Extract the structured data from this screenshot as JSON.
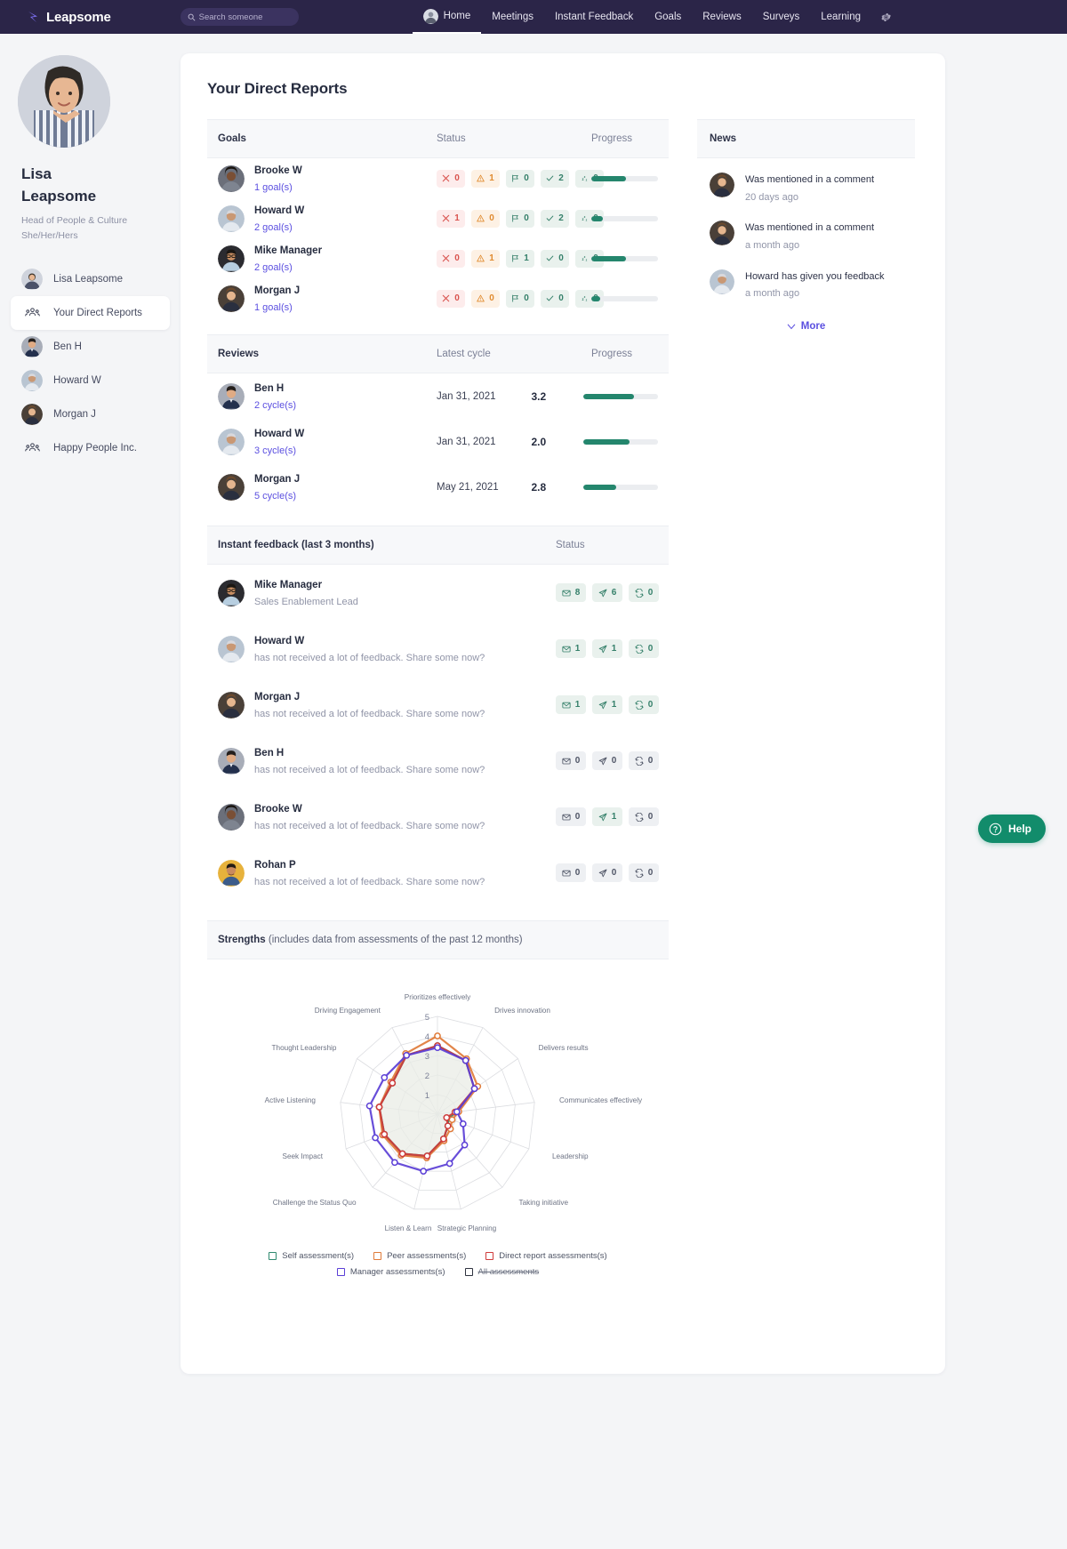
{
  "nav": {
    "brand": "Leapsome",
    "search_placeholder": "Search someone",
    "items": [
      {
        "label": "Home",
        "active": true
      },
      {
        "label": "Meetings",
        "active": false
      },
      {
        "label": "Instant Feedback",
        "active": false
      },
      {
        "label": "Goals",
        "active": false
      },
      {
        "label": "Reviews",
        "active": false
      },
      {
        "label": "Surveys",
        "active": false
      },
      {
        "label": "Learning",
        "active": false
      }
    ]
  },
  "sidebar": {
    "name": "Lisa\nLeapsome",
    "name_line1": "Lisa",
    "name_line2": "Leapsome",
    "role": "Head of People & Culture",
    "pronouns": "She/Her/Hers",
    "items": [
      {
        "label": "Lisa Leapsome",
        "type": "avatar",
        "selected": false
      },
      {
        "label": "Your Direct Reports",
        "type": "group-icon",
        "selected": true
      },
      {
        "label": "Ben H",
        "type": "avatar",
        "selected": false
      },
      {
        "label": "Howard W",
        "type": "avatar",
        "selected": false
      },
      {
        "label": "Morgan J",
        "type": "avatar",
        "selected": false
      },
      {
        "label": "Happy People Inc.",
        "type": "group-icon",
        "selected": false
      }
    ]
  },
  "main": {
    "page_title": "Your Direct Reports",
    "goals": {
      "header": {
        "title": "Goals",
        "status": "Status",
        "progress": "Progress"
      },
      "rows": [
        {
          "name": "Brooke W",
          "link": "1 goal(s)",
          "chips": [
            {
              "icon": "x",
              "tone": "red",
              "value": "0"
            },
            {
              "icon": "warn",
              "tone": "amber",
              "value": "1"
            },
            {
              "icon": "flag",
              "tone": "green",
              "value": "0"
            },
            {
              "icon": "check",
              "tone": "green",
              "value": "2"
            },
            {
              "icon": "zzz",
              "tone": "green",
              "value": "0"
            }
          ],
          "progress": 52
        },
        {
          "name": "Howard W",
          "link": "2 goal(s)",
          "chips": [
            {
              "icon": "x",
              "tone": "red",
              "value": "1"
            },
            {
              "icon": "warn",
              "tone": "amber",
              "value": "0"
            },
            {
              "icon": "flag",
              "tone": "green",
              "value": "0"
            },
            {
              "icon": "check",
              "tone": "green",
              "value": "2"
            },
            {
              "icon": "zzz",
              "tone": "green",
              "value": "0"
            }
          ],
          "progress": 17
        },
        {
          "name": "Mike Manager",
          "link": "2 goal(s)",
          "chips": [
            {
              "icon": "x",
              "tone": "red",
              "value": "0"
            },
            {
              "icon": "warn",
              "tone": "amber",
              "value": "1"
            },
            {
              "icon": "flag",
              "tone": "green",
              "value": "1"
            },
            {
              "icon": "check",
              "tone": "green",
              "value": "0"
            },
            {
              "icon": "zzz",
              "tone": "green",
              "value": "0"
            }
          ],
          "progress": 52
        },
        {
          "name": "Morgan J",
          "link": "1 goal(s)",
          "chips": [
            {
              "icon": "x",
              "tone": "red",
              "value": "0"
            },
            {
              "icon": "warn",
              "tone": "amber",
              "value": "0"
            },
            {
              "icon": "flag",
              "tone": "green",
              "value": "0"
            },
            {
              "icon": "check",
              "tone": "green",
              "value": "0"
            },
            {
              "icon": "zzz",
              "tone": "green",
              "value": "0"
            }
          ],
          "progress": 13
        }
      ]
    },
    "reviews": {
      "header": {
        "title": "Reviews",
        "cycle": "Latest cycle",
        "progress": "Progress"
      },
      "rows": [
        {
          "name": "Ben H",
          "link": "2 cycle(s)",
          "date": "Jan 31, 2021",
          "score": "3.2",
          "progress": 68
        },
        {
          "name": "Howard W",
          "link": "3 cycle(s)",
          "date": "Jan 31, 2021",
          "score": "2.0",
          "progress": 62
        },
        {
          "name": "Morgan J",
          "link": "5 cycle(s)",
          "date": "May 21, 2021",
          "score": "2.8",
          "progress": 44
        }
      ]
    },
    "feedback": {
      "header": {
        "title": "Instant feedback (last 3 months)",
        "status": "Status"
      },
      "rows": [
        {
          "name": "Mike Manager",
          "sub": "Sales Enablement Lead",
          "sub_type": "role",
          "chips": [
            {
              "icon": "envelope",
              "value": "8",
              "on": true
            },
            {
              "icon": "paper-plane",
              "value": "6",
              "on": true
            },
            {
              "icon": "loop",
              "value": "0",
              "on": true
            }
          ]
        },
        {
          "name": "Howard W",
          "sub": "has not received a lot of feedback. Share some now?",
          "sub_type": "prompt",
          "chips": [
            {
              "icon": "envelope",
              "value": "1",
              "on": true
            },
            {
              "icon": "paper-plane",
              "value": "1",
              "on": true
            },
            {
              "icon": "loop",
              "value": "0",
              "on": true
            }
          ]
        },
        {
          "name": "Morgan J",
          "sub": "has not received a lot of feedback. Share some now?",
          "sub_type": "prompt",
          "chips": [
            {
              "icon": "envelope",
              "value": "1",
              "on": true
            },
            {
              "icon": "paper-plane",
              "value": "1",
              "on": true
            },
            {
              "icon": "loop",
              "value": "0",
              "on": true
            }
          ]
        },
        {
          "name": "Ben H",
          "sub": "has not received a lot of feedback. Share some now?",
          "sub_type": "prompt",
          "chips": [
            {
              "icon": "envelope",
              "value": "0",
              "on": false
            },
            {
              "icon": "paper-plane",
              "value": "0",
              "on": false
            },
            {
              "icon": "loop",
              "value": "0",
              "on": false
            }
          ]
        },
        {
          "name": "Brooke W",
          "sub": "has not received a lot of feedback. Share some now?",
          "sub_type": "prompt",
          "chips": [
            {
              "icon": "envelope",
              "value": "0",
              "on": false
            },
            {
              "icon": "paper-plane",
              "value": "1",
              "on": true
            },
            {
              "icon": "loop",
              "value": "0",
              "on": false
            }
          ]
        },
        {
          "name": "Rohan P",
          "sub": "has not received a lot of feedback. Share some now?",
          "sub_type": "prompt",
          "chips": [
            {
              "icon": "envelope",
              "value": "0",
              "on": false
            },
            {
              "icon": "paper-plane",
              "value": "0",
              "on": false
            },
            {
              "icon": "loop",
              "value": "0",
              "on": false
            }
          ]
        }
      ]
    },
    "strengths": {
      "title_bold": "Strengths",
      "title_rest": " (includes data from assessments of the past 12 months)"
    }
  },
  "news": {
    "title": "News",
    "items": [
      {
        "text": "Was mentioned in a comment",
        "time": "20 days ago"
      },
      {
        "text": "Was mentioned in a comment",
        "time": "a month ago"
      },
      {
        "text": "Howard has given you feedback",
        "time": "a month ago"
      }
    ],
    "more_label": "More"
  },
  "help": {
    "label": "Help"
  },
  "chart_data": {
    "type": "radar",
    "title": "Strengths",
    "axes": [
      "Prioritizes effectively",
      "Drives innovation",
      "Delivers results",
      "Communicates effectively",
      "Leadership",
      "Taking initiative",
      "Strategic Planning",
      "Listen & Learn",
      "Challenge the Status Quo",
      "Seek Impact",
      "Active Listening",
      "Thought Leadership",
      "Driving Engagement"
    ],
    "rticks": [
      1,
      2,
      3,
      4,
      5
    ],
    "rlim": [
      0,
      5
    ],
    "grid": true,
    "legend_position": "bottom",
    "series": [
      {
        "name": "Self assessment(s)",
        "color": "#2f8a6f",
        "enabled": true,
        "values": [
          3.5,
          3.1,
          2.3,
          1.0,
          0.6,
          0.8,
          1.3,
          2.2,
          2.7,
          2.9,
          3.0,
          2.8,
          3.4
        ]
      },
      {
        "name": "Peer assessments(s)",
        "color": "#e07b39",
        "enabled": true,
        "values": [
          4.0,
          3.2,
          2.5,
          1.1,
          0.8,
          1.0,
          1.4,
          2.3,
          2.8,
          3.0,
          3.0,
          2.9,
          3.5
        ]
      },
      {
        "name": "Direct report assessments(s)",
        "color": "#cf3b3b",
        "enabled": true,
        "values": [
          3.5,
          3.1,
          2.3,
          0.9,
          0.5,
          0.8,
          1.3,
          2.2,
          2.7,
          2.9,
          3.0,
          2.8,
          3.4
        ]
      },
      {
        "name": "Manager assessments(s)",
        "color": "#5b3fd6",
        "enabled": true,
        "values": [
          3.4,
          3.1,
          2.3,
          1.0,
          1.4,
          2.1,
          2.6,
          3.0,
          3.3,
          3.4,
          3.5,
          3.3,
          3.4
        ]
      },
      {
        "name": "All assessments",
        "color": "#2f3340",
        "enabled": false,
        "values": [
          3.5,
          3.1,
          2.3,
          1.0,
          0.7,
          0.9,
          1.3,
          2.2,
          2.7,
          2.9,
          3.0,
          2.8,
          3.4
        ]
      }
    ]
  }
}
